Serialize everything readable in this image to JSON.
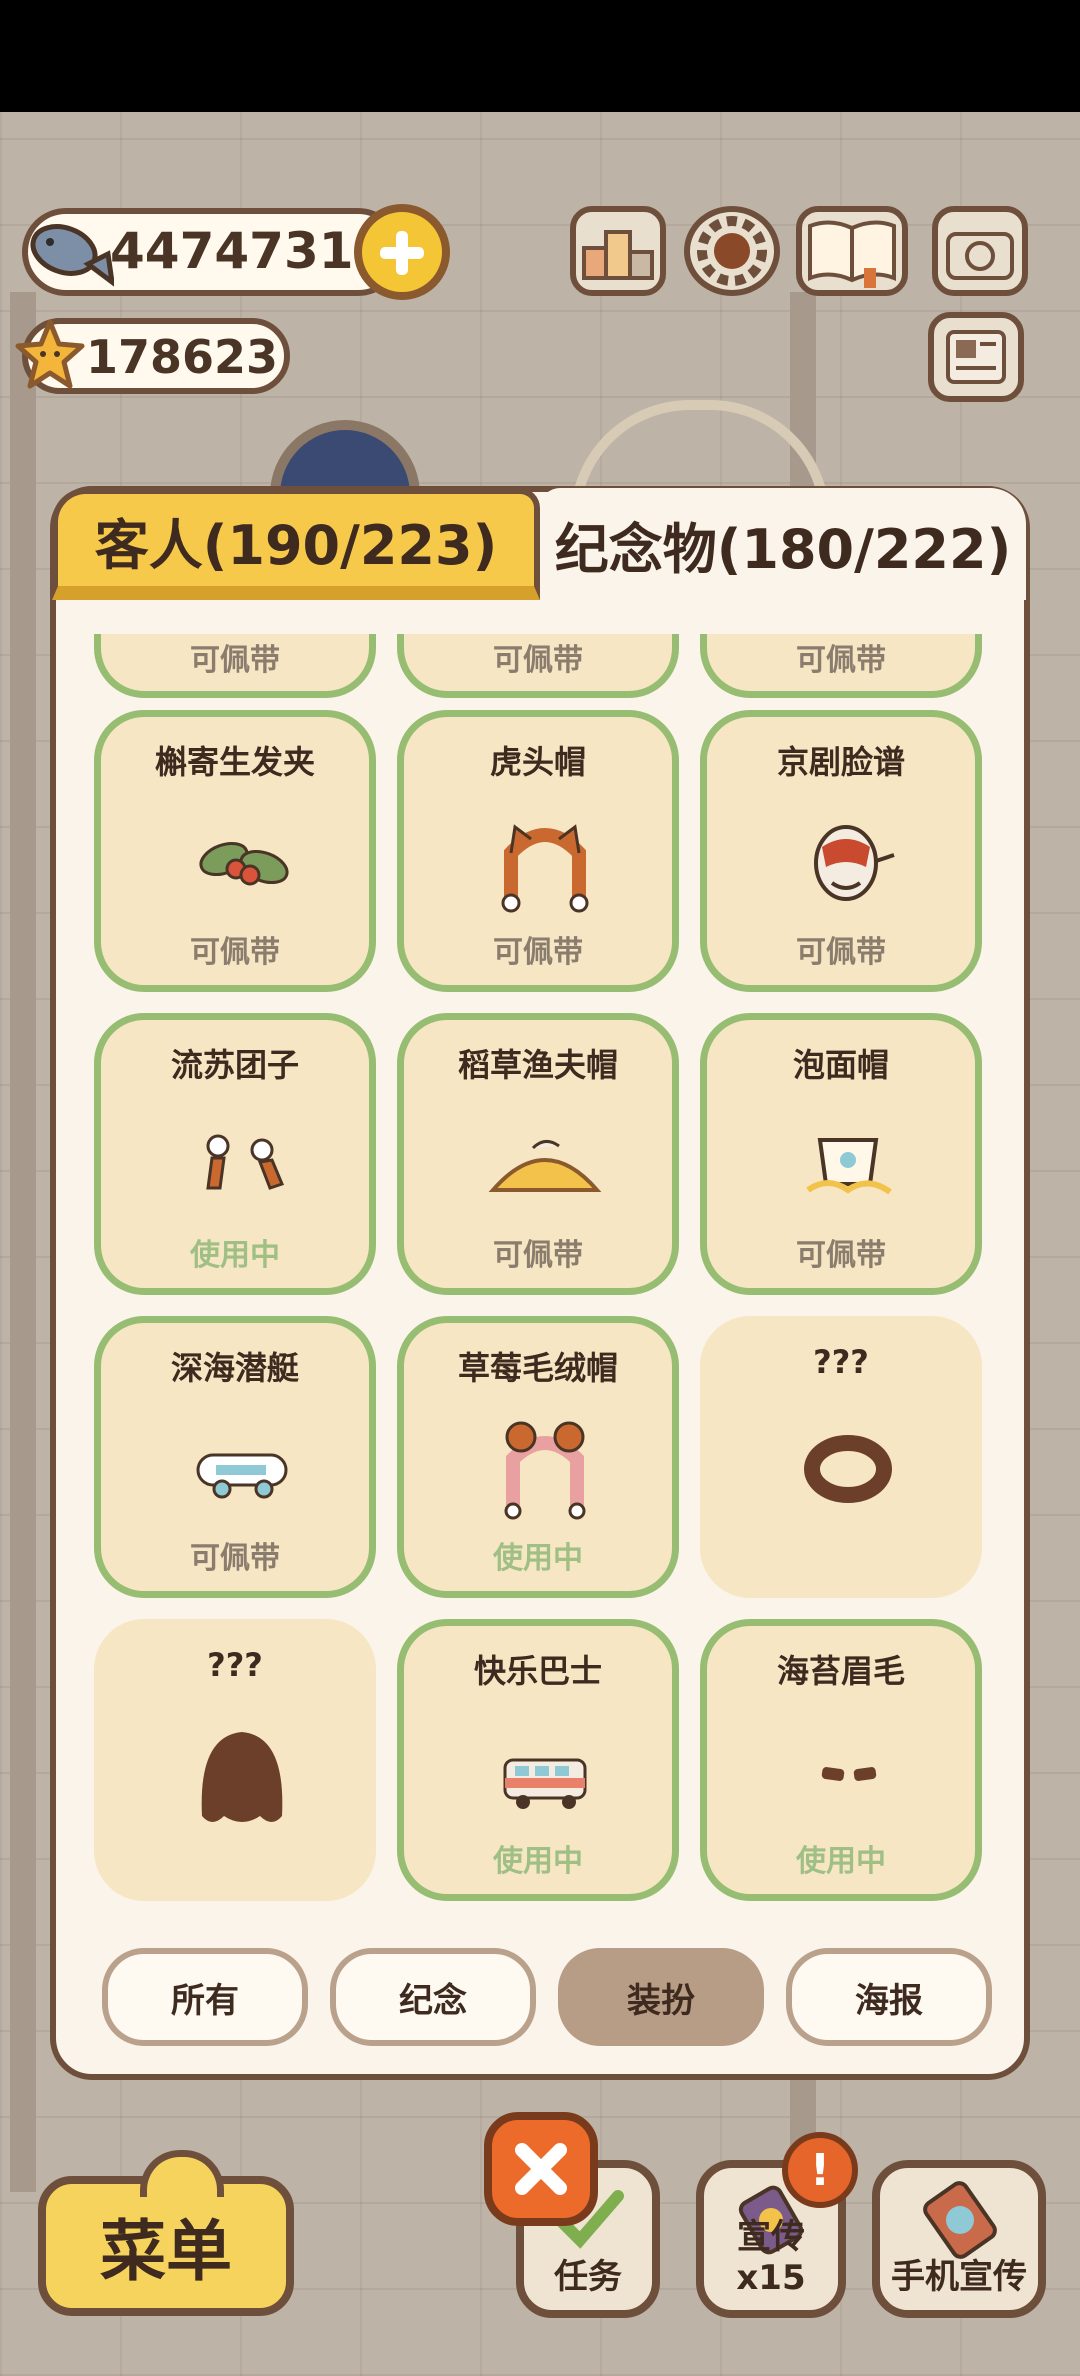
{
  "hud": {
    "fish_count": "447473107",
    "star_count": "178623"
  },
  "tabs": [
    {
      "label": "客人(190/223)",
      "active": false
    },
    {
      "label": "纪念物(180/222)",
      "active": true
    }
  ],
  "partial_row": [
    "可佩带",
    "可佩带",
    "可佩带"
  ],
  "items": [
    {
      "name": "槲寄生发夹",
      "status": "可佩带",
      "in_use": false,
      "locked": false,
      "icon": "mistletoe-hairclip-icon"
    },
    {
      "name": "虎头帽",
      "status": "可佩带",
      "in_use": false,
      "locked": false,
      "icon": "tiger-hat-icon"
    },
    {
      "name": "京剧脸谱",
      "status": "可佩带",
      "in_use": false,
      "locked": false,
      "icon": "opera-mask-icon"
    },
    {
      "name": "流苏团子",
      "status": "使用中",
      "in_use": true,
      "locked": false,
      "icon": "tassel-dumpling-icon"
    },
    {
      "name": "稻草渔夫帽",
      "status": "可佩带",
      "in_use": false,
      "locked": false,
      "icon": "straw-fisher-hat-icon"
    },
    {
      "name": "泡面帽",
      "status": "可佩带",
      "in_use": false,
      "locked": false,
      "icon": "noodle-hat-icon"
    },
    {
      "name": "深海潜艇",
      "status": "可佩带",
      "in_use": false,
      "locked": false,
      "icon": "submarine-icon"
    },
    {
      "name": "草莓毛绒帽",
      "status": "使用中",
      "in_use": true,
      "locked": false,
      "icon": "strawberry-hat-icon"
    },
    {
      "name": "???",
      "status": "",
      "in_use": false,
      "locked": true,
      "icon": "locked-silhouette-wreath-icon"
    },
    {
      "name": "???",
      "status": "",
      "in_use": false,
      "locked": true,
      "icon": "locked-silhouette-hair-icon"
    },
    {
      "name": "快乐巴士",
      "status": "使用中",
      "in_use": true,
      "locked": false,
      "icon": "happy-bus-icon"
    },
    {
      "name": "海苔眉毛",
      "status": "使用中",
      "in_use": true,
      "locked": false,
      "icon": "seaweed-eyebrows-icon"
    }
  ],
  "filters": [
    {
      "label": "所有",
      "active": false
    },
    {
      "label": "纪念",
      "active": false
    },
    {
      "label": "装扮",
      "active": true
    },
    {
      "label": "海报",
      "active": false
    }
  ],
  "bottom_bar": {
    "menu_label": "菜单",
    "task_label": "任务",
    "promo_label": "宣传x15",
    "phone_promo_label": "手机宣传",
    "alert_badge": "!"
  },
  "colors": {
    "card_border_green": "#97bd73",
    "card_fill": "#f6e6c4",
    "in_use_text": "#9fbf84",
    "active_tab_yellow": "#f6c94a",
    "active_filter": "#b89d86",
    "brown_outline": "#6e4f3c"
  }
}
